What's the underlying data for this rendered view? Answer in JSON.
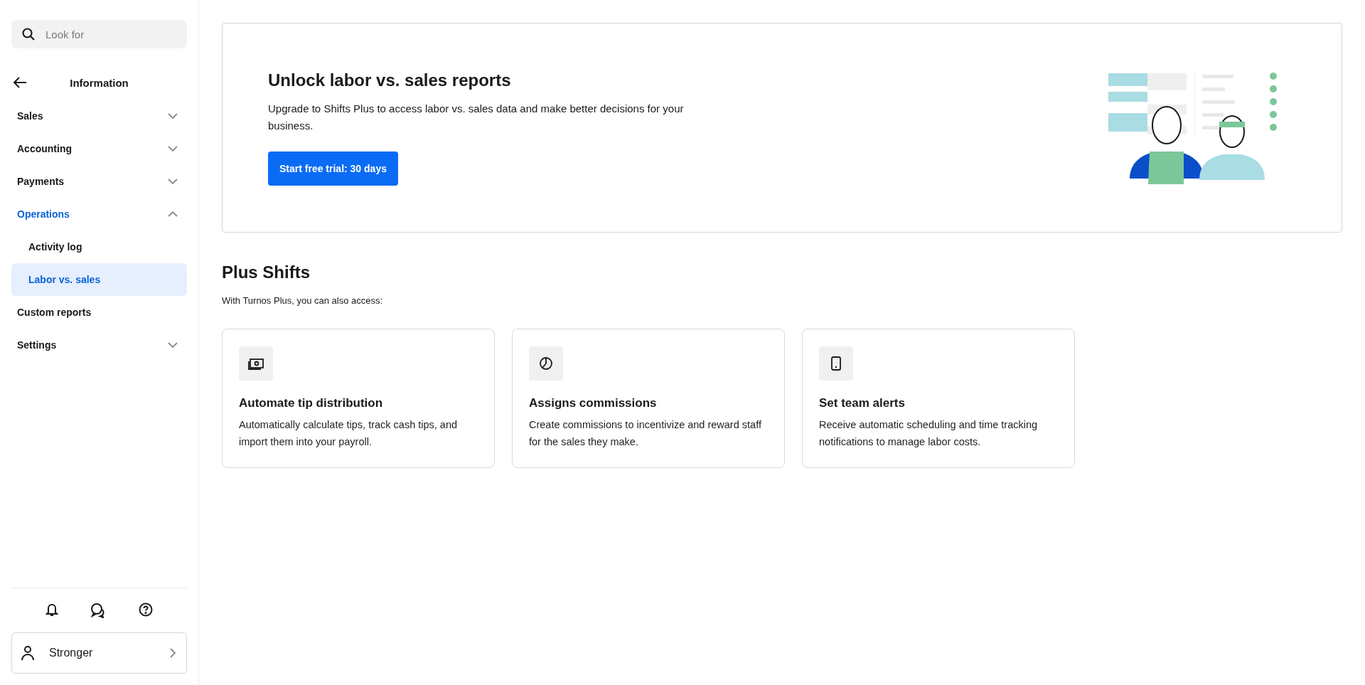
{
  "search": {
    "placeholder": "Look for"
  },
  "sidebar": {
    "header": "Information",
    "items": [
      {
        "label": "Sales",
        "kind": "group",
        "expanded": false,
        "selected": false
      },
      {
        "label": "Accounting",
        "kind": "group",
        "expanded": false,
        "selected": false
      },
      {
        "label": "Payments",
        "kind": "group",
        "expanded": false,
        "selected": false
      },
      {
        "label": "Operations",
        "kind": "group",
        "expanded": true,
        "selected": false,
        "children": [
          {
            "label": "Activity log",
            "selected": false
          },
          {
            "label": "Labor vs. sales",
            "selected": true
          }
        ]
      },
      {
        "label": "Custom reports",
        "kind": "link",
        "expanded": false,
        "selected": false
      },
      {
        "label": "Settings",
        "kind": "group",
        "expanded": false,
        "selected": false
      }
    ],
    "user": {
      "name": "Stronger"
    }
  },
  "banner": {
    "title": "Unlock labor vs. sales reports",
    "text": "Upgrade to Shifts Plus to access labor vs. sales data and make better decisions for your business.",
    "button": "Start free trial: 30 days"
  },
  "section": {
    "title": "Plus Shifts",
    "subtitle": "With Turnos Plus, you can also access:"
  },
  "features": [
    {
      "title": "Automate tip distribution",
      "text": "Automatically calculate tips, track cash tips, and import them into your payroll."
    },
    {
      "title": "Assigns commissions",
      "text": "Create commissions to incentivize and reward staff for the sales they make."
    },
    {
      "title": "Set team alerts",
      "text": "Receive automatic scheduling and time tracking notifications to manage labor costs."
    }
  ]
}
